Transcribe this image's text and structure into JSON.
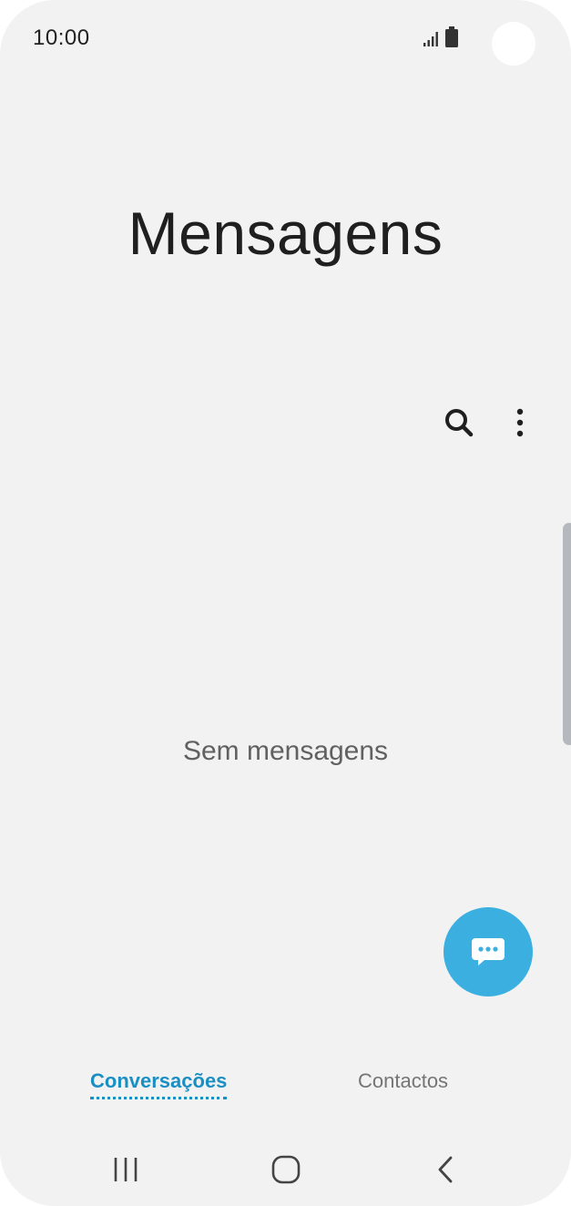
{
  "status_bar": {
    "time": "10:00",
    "icons": [
      "signal-icon",
      "battery-icon"
    ]
  },
  "header": {
    "title": "Mensagens"
  },
  "toolbar": {
    "icons": [
      "search-icon",
      "more-vertical-icon"
    ]
  },
  "main": {
    "empty_message": "Sem mensagens"
  },
  "fab": {
    "icon": "chat-bubble-dots-icon",
    "color": "#3bb0e0"
  },
  "tabs": [
    {
      "label": "Conversações",
      "selected": true
    },
    {
      "label": "Contactos",
      "selected": false
    }
  ],
  "navigation_bar": {
    "icons": [
      "recent-apps-icon",
      "home-icon",
      "back-icon"
    ]
  },
  "colors": {
    "accent": "#1a8fc4",
    "background": "#f2f2f2"
  }
}
